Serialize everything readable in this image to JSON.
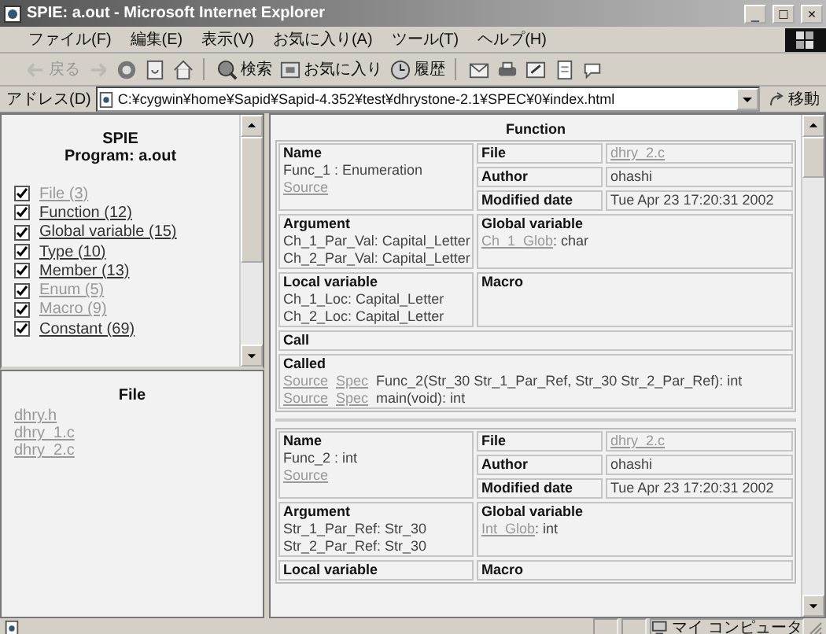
{
  "window": {
    "title": "SPIE: a.out - Microsoft Internet Explorer",
    "controls": [
      "_",
      "□",
      "×"
    ]
  },
  "menu": [
    "ファイル(F)",
    "編集(E)",
    "表示(V)",
    "お気に入り(A)",
    "ツール(T)",
    "ヘルプ(H)"
  ],
  "toolbar": [
    [
      {
        "kind": "back",
        "label": "戻る",
        "disabled": true
      },
      {
        "kind": "forward",
        "disabled": true
      },
      {
        "kind": "stop",
        "disabled": false
      },
      {
        "kind": "refresh",
        "disabled": false
      },
      {
        "kind": "home",
        "disabled": false
      }
    ],
    [
      {
        "kind": "search",
        "label": "検索",
        "disabled": false
      },
      {
        "kind": "favorites",
        "label": "お気に入り",
        "disabled": false
      },
      {
        "kind": "history",
        "label": "履歴",
        "disabled": false
      }
    ],
    [
      {
        "kind": "mail",
        "disabled": false
      },
      {
        "kind": "print",
        "disabled": false
      },
      {
        "kind": "edit",
        "disabled": false
      },
      {
        "kind": "page",
        "disabled": false
      },
      {
        "kind": "discuss",
        "disabled": false
      }
    ]
  ],
  "address": {
    "label": "アドレス(D)",
    "value": "C:¥cygwin¥home¥Sapid¥Sapid-4.352¥test¥dhrystone-2.1¥SPEC¥0¥index.html",
    "go": "移動"
  },
  "index_frame": {
    "title": "SPIE",
    "subtitle": "Program: a.out",
    "items": [
      {
        "label": "File (3)",
        "checked": true,
        "visited": true
      },
      {
        "label": "Function (12)",
        "checked": true,
        "visited": false
      },
      {
        "label": "Global variable (15)",
        "checked": true,
        "visited": false
      },
      {
        "label": "Type (10)",
        "checked": true,
        "visited": false
      },
      {
        "label": "Member (13)",
        "checked": true,
        "visited": false
      },
      {
        "label": "Enum (5)",
        "checked": true,
        "visited": true
      },
      {
        "label": "Macro (9)",
        "checked": true,
        "visited": true
      },
      {
        "label": "Constant (69)",
        "checked": true,
        "visited": false
      }
    ]
  },
  "file_frame": {
    "title": "File",
    "links": [
      "dhry.h",
      "dhry_1.c",
      "dhry_2.c"
    ]
  },
  "content": {
    "heading": "Function",
    "functions": [
      {
        "name": {
          "label": "Name",
          "value": "Func_1 : Enumeration",
          "link": "Source"
        },
        "meta": [
          {
            "label": "File",
            "value": "dhry_2.c",
            "kind": "link"
          },
          {
            "label": "Author",
            "value": "ohashi",
            "kind": "text"
          },
          {
            "label": "Modified date",
            "value": "Tue Apr 23 17:20:31 2002",
            "kind": "text"
          }
        ],
        "argument": {
          "label": "Argument",
          "lines": [
            "Ch_1_Par_Val: Capital_Letter",
            "Ch_2_Par_Val: Capital_Letter"
          ]
        },
        "global": {
          "label": "Global variable",
          "entries": [
            {
              "link": "Ch_1_Glob",
              "type": ": char"
            }
          ]
        },
        "local": {
          "label": "Local variable",
          "lines": [
            "Ch_1_Loc: Capital_Letter",
            "Ch_2_Loc: Capital_Letter"
          ]
        },
        "macro": {
          "label": "Macro"
        },
        "call": {
          "label": "Call"
        },
        "called": {
          "label": "Called",
          "entries": [
            {
              "source": "Source",
              "spec": "Spec",
              "signature": "Func_2(Str_30 Str_1_Par_Ref, Str_30 Str_2_Par_Ref): int"
            },
            {
              "source": "Source",
              "spec": "Spec",
              "signature": "main(void): int"
            }
          ]
        }
      },
      {
        "name": {
          "label": "Name",
          "value": "Func_2 : int",
          "link": "Source"
        },
        "meta": [
          {
            "label": "File",
            "value": "dhry_2.c",
            "kind": "link"
          },
          {
            "label": "Author",
            "value": "ohashi",
            "kind": "text"
          },
          {
            "label": "Modified date",
            "value": "Tue Apr 23 17:20:31 2002",
            "kind": "text"
          }
        ],
        "argument": {
          "label": "Argument",
          "lines": [
            "Str_1_Par_Ref: Str_30",
            "Str_2_Par_Ref: Str_30"
          ]
        },
        "global": {
          "label": "Global variable",
          "entries": [
            {
              "link": "Int_Glob",
              "type": ": int"
            }
          ]
        },
        "local": {
          "label": "Local variable"
        },
        "macro": {
          "label": "Macro"
        }
      }
    ]
  },
  "status_bar": {
    "zone": "マイ コンピュータ"
  }
}
